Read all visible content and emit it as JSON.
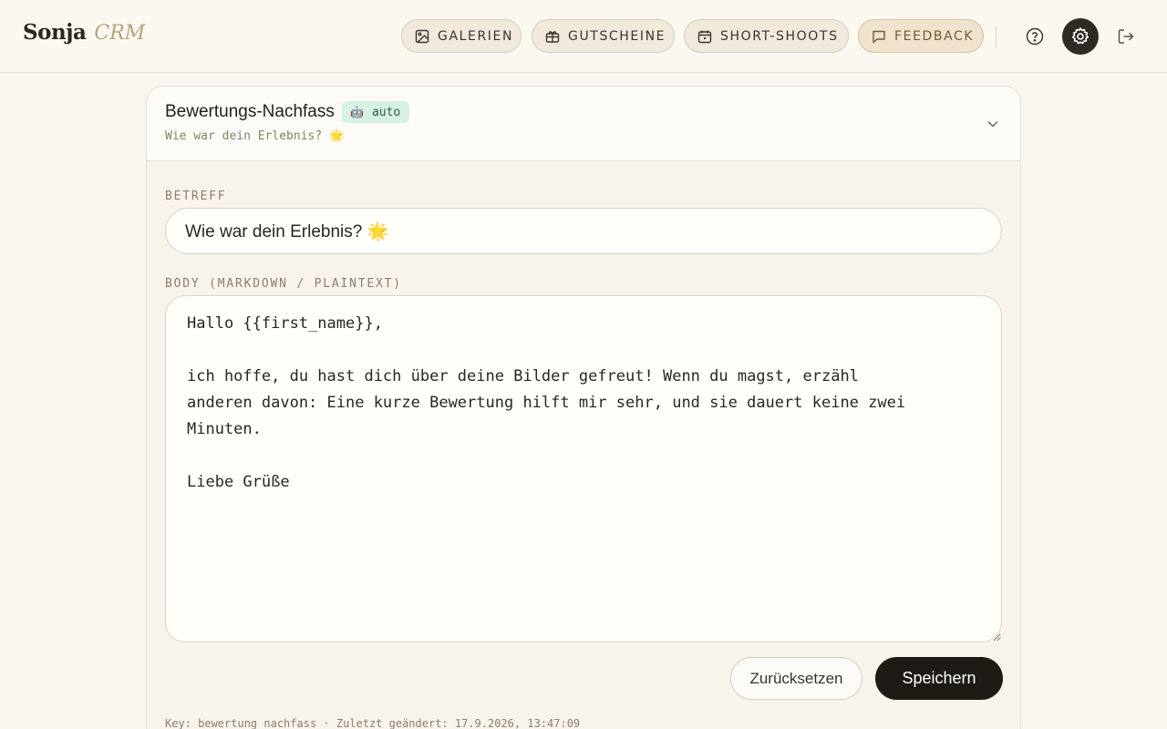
{
  "brand": {
    "name": "Sonja",
    "tagline": "CRM"
  },
  "nav": [
    {
      "label": "GALERIEN",
      "icon": "image-icon"
    },
    {
      "label": "GUTSCHEINE",
      "icon": "gift-icon"
    },
    {
      "label": "SHORT-SHOOTS",
      "icon": "calendar-icon"
    },
    {
      "label": "FEEDBACK",
      "icon": "message-icon"
    }
  ],
  "header_icons": [
    "help-icon",
    "gear-icon",
    "logout-icon"
  ],
  "template": {
    "title": "Bewertungs-Nachfass",
    "badge": {
      "icon": "robot-icon",
      "label": "auto"
    },
    "subtitle": "Wie war dein Erlebnis? 🌟"
  },
  "form": {
    "subject_label": "BETREFF",
    "subject_value": "Wie war dein Erlebnis? 🌟",
    "body_label": "BODY (MARKDOWN / PLAINTEXT)",
    "body_value": "Hallo {{first_name}},\n\nich hoffe, du hast dich über deine Bilder gefreut! Wenn du magst, erzähl\nanderen davon: Eine kurze Bewertung hilft mir sehr, und sie dauert keine zwei\nMinuten.\n\nLiebe Grüße"
  },
  "actions": {
    "reset_label": "Zurücksetzen",
    "save_label": "Speichern"
  },
  "meta": {
    "text": "Key: bewertung_nachfass · Zuletzt geändert: 17.9.2026, 13:47:09"
  },
  "colors": {
    "accent": "#b9a27a",
    "primary_button": "#1e1a15",
    "badge_bg": "#d6f2e2",
    "background": "#faf6ef"
  }
}
